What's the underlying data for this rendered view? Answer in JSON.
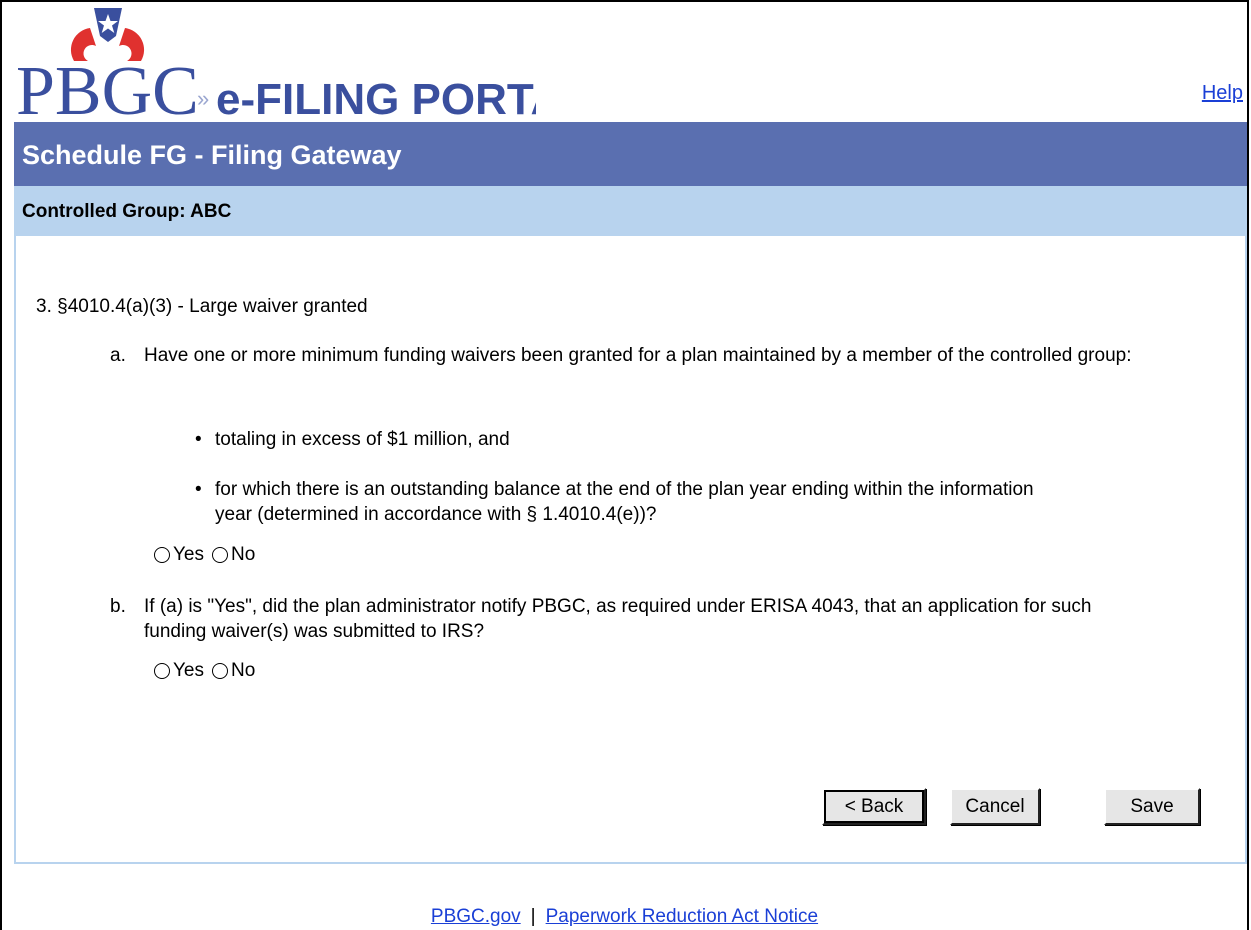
{
  "header": {
    "logo_text": "PBGC",
    "logo_subtitle": "e-FILING PORTAL",
    "help_label": "Help"
  },
  "title_bar": {
    "title": "Schedule FG - Filing Gateway"
  },
  "sub_bar": {
    "label": "Controlled Group: ABC"
  },
  "question": {
    "title": "3. §4010.4(a)(3) - Large waiver granted",
    "a": {
      "label": "a.",
      "text": "Have one or more minimum funding waivers been granted for a plan maintained by a member of the controlled group:",
      "bullets": [
        "totaling in excess of $1 million, and",
        "for which there is an outstanding balance at the end of the plan year ending within the information year (determined in accordance with § 1.4010.4(e))?"
      ],
      "yes_label": "Yes",
      "no_label": "No"
    },
    "b": {
      "label": "b.",
      "text": "If (a) is \"Yes\", did the plan administrator notify PBGC, as required under ERISA 4043, that an application for such funding waiver(s) was submitted to IRS?",
      "yes_label": "Yes",
      "no_label": "No"
    }
  },
  "buttons": {
    "back": "< Back",
    "cancel": "Cancel",
    "save": "Save"
  },
  "footer": {
    "link1": "PBGC.gov",
    "separator": "|",
    "link2": "Paperwork Reduction Act Notice"
  },
  "colors": {
    "title_bar": "#5a6fb0",
    "sub_bar": "#b8d3ee",
    "logo_red": "#e0312f",
    "logo_blue": "#3a4f9e",
    "link": "#1a3fd6"
  },
  "icons": [
    "logo-star-icon"
  ]
}
